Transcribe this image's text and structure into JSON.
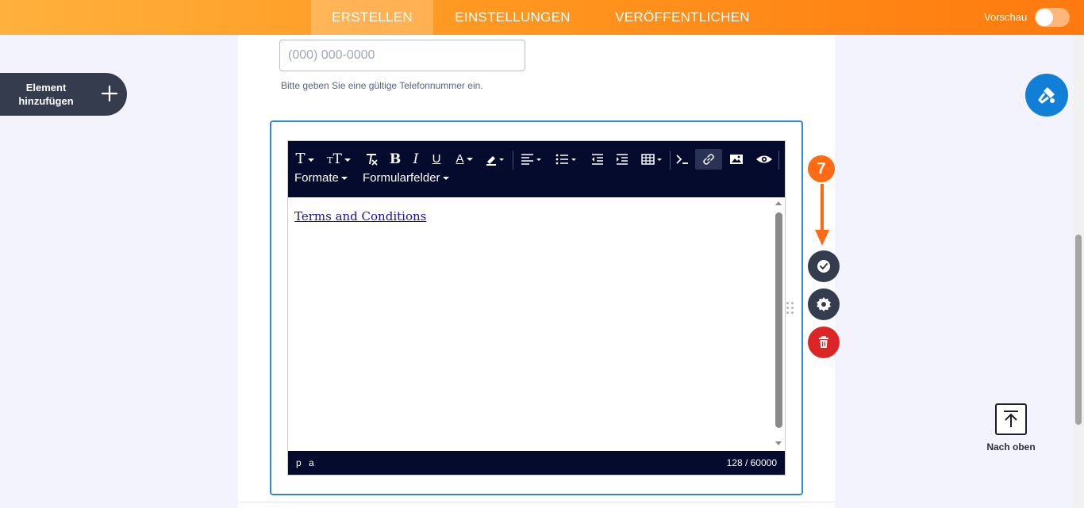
{
  "header": {
    "tabs": [
      {
        "label": "ERSTELLEN",
        "active": true
      },
      {
        "label": "EINSTELLUNGEN",
        "active": false
      },
      {
        "label": "VERÖFFENTLICHEN",
        "active": false
      }
    ],
    "preview_label": "Vorschau",
    "preview_enabled": false
  },
  "sidebar": {
    "add_element_label": "Element hinzufügen",
    "add_icon": "plus-icon"
  },
  "form": {
    "phone": {
      "placeholder": "(000) 000-0000",
      "value": "",
      "hint": "Bitte geben Sie eine gültige Telefonnummer ein."
    },
    "editor": {
      "toolbar": {
        "buttons": [
          "font-family",
          "font-size",
          "clear-formatting",
          "bold",
          "italic",
          "underline",
          "text-color",
          "background-color",
          "align",
          "unordered-list",
          "outdent",
          "indent",
          "table",
          "code-view",
          "link",
          "image",
          "preview"
        ],
        "menus": [
          "Formate",
          "Formularfelder"
        ]
      },
      "content_link": "Terms and Conditions",
      "status_path": "p a",
      "char_count": "128 / 60000"
    }
  },
  "field_actions": {
    "icons": [
      "check-circle-icon",
      "gear-icon",
      "trash-icon"
    ]
  },
  "step_marker": "7",
  "back_to_top_label": "Nach oben",
  "colors": {
    "accent": "#ff8a1f",
    "toolbar": "#050b2c",
    "selection": "#2e8ad8",
    "danger": "#dc2626",
    "action": "#343c4e",
    "designer": "#0f7fd8"
  }
}
